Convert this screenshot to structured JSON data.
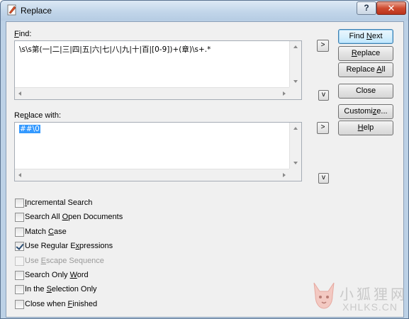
{
  "window": {
    "title": "Replace",
    "help_button": "?",
    "close_button": "✕"
  },
  "find": {
    "label_underlined": "F",
    "label_rest": "ind:",
    "value": "\\s\\s第(一|二|三|四|五|六|七|八|九|十|百|[0-9])+(章)\\s+.*",
    "insert_button": ">",
    "history_button": "v"
  },
  "replace_with": {
    "label_pre": "Re",
    "label_underlined": "p",
    "label_rest": "lace with:",
    "value": "##\\0",
    "insert_button": ">",
    "history_button": "v"
  },
  "buttons": {
    "find_next_pre": "Find ",
    "find_next_ul": "N",
    "find_next_post": "ext",
    "replace_pre": "",
    "replace_ul": "R",
    "replace_post": "eplace",
    "replace_all_pre": "Replace ",
    "replace_all_ul": "A",
    "replace_all_post": "ll",
    "close": "Close",
    "customize_pre": "Customi",
    "customize_ul": "z",
    "customize_post": "e...",
    "help_pre": "",
    "help_ul": "H",
    "help_post": "elp"
  },
  "options": [
    {
      "pre": "",
      "ul": "I",
      "post": "ncremental Search",
      "checked": false,
      "disabled": false
    },
    {
      "pre": "Search All ",
      "ul": "O",
      "post": "pen Documents",
      "checked": false,
      "disabled": false
    },
    {
      "pre": "Match ",
      "ul": "C",
      "post": "ase",
      "checked": false,
      "disabled": false
    },
    {
      "pre": "Use Regular E",
      "ul": "x",
      "post": "pressions",
      "checked": true,
      "disabled": false
    },
    {
      "pre": "Use ",
      "ul": "E",
      "post": "scape Sequence",
      "checked": false,
      "disabled": true
    },
    {
      "pre": "Search Only ",
      "ul": "W",
      "post": "ord",
      "checked": false,
      "disabled": false
    },
    {
      "pre": "In the ",
      "ul": "S",
      "post": "election Only",
      "checked": false,
      "disabled": false
    },
    {
      "pre": "Close when ",
      "ul": "F",
      "post": "inished",
      "checked": false,
      "disabled": false
    }
  ],
  "watermark": {
    "cn": "小狐狸网",
    "en": "XHLKS.CN"
  }
}
